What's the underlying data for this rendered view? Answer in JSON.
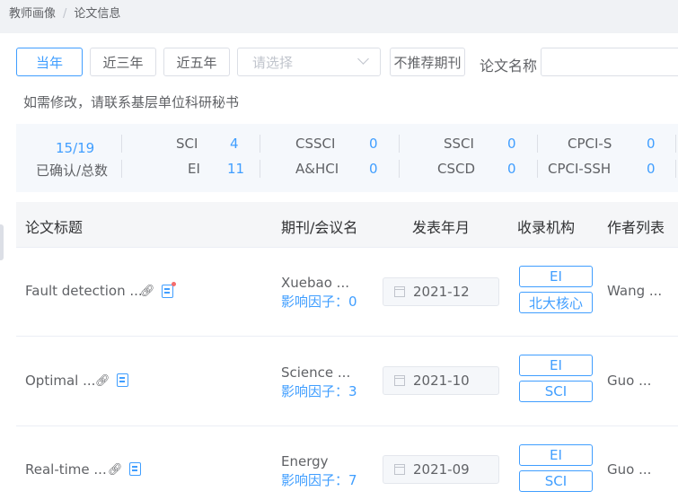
{
  "breadcrumb": {
    "root": "教师画像",
    "separator": "/",
    "current": "论文信息"
  },
  "filters": {
    "current_year": "当年",
    "last3": "近三年",
    "last5": "近五年",
    "select_placeholder": "请选择",
    "not_recommended": "不推荐期刊",
    "name_label": "论文名称",
    "name_value": ""
  },
  "hint": "如需修改，请联系基层单位科研秘书",
  "stats": {
    "ratio": "15/19",
    "ratio_label": "已确认/总数",
    "items": [
      {
        "name": "SCI",
        "value": "4"
      },
      {
        "name": "EI",
        "value": "11"
      },
      {
        "name": "CSSCI",
        "value": "0"
      },
      {
        "name": "A&HCI",
        "value": "0"
      },
      {
        "name": "SSCI",
        "value": "0"
      },
      {
        "name": "CSCD",
        "value": "0"
      },
      {
        "name": "CPCI-S",
        "value": "0"
      },
      {
        "name": "CPCI-SSH",
        "value": "0"
      }
    ]
  },
  "table": {
    "headers": {
      "title": "论文标题",
      "journal": "期刊/会议名",
      "date": "发表年月",
      "index": "收录机构",
      "authors": "作者列表"
    },
    "rows": [
      {
        "title": "Fault detection ...",
        "journal": "Xuebao ...",
        "impact": "影响因子：0",
        "date": "2021-12",
        "tags": [
          "EI",
          "北大核心"
        ],
        "authors": "Wang ..."
      },
      {
        "title": "Optimal ...",
        "journal": "Science ...",
        "impact": "影响因子：3",
        "date": "2021-10",
        "tags": [
          "EI",
          "SCI"
        ],
        "authors": "Guo ..."
      },
      {
        "title": "Real-time ...",
        "journal": "Energy",
        "impact": "影响因子：7",
        "date": "2021-09",
        "tags": [
          "EI",
          "SCI"
        ],
        "authors": "Guo ..."
      }
    ]
  },
  "icons": {
    "link": "link-icon",
    "note": "note-icon"
  },
  "colors": {
    "accent": "#409eff",
    "alert_dot": "#f56c6c"
  }
}
